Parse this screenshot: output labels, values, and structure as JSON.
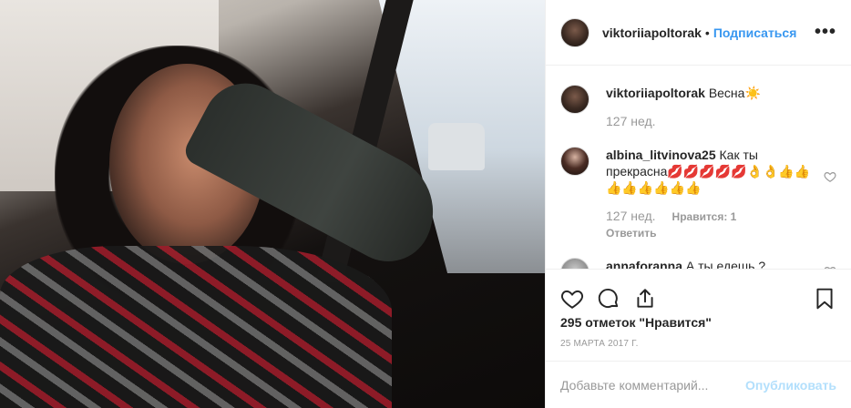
{
  "post": {
    "author": "viktoriiapoltorak",
    "separator": "•",
    "follow_label": "Подписаться",
    "more_label": "•••"
  },
  "comments": [
    {
      "user": "viktoriiapoltorak",
      "text": "Весна☀️",
      "time": "127 нед.",
      "likes": "",
      "reply": ""
    },
    {
      "user": "albina_litvinova25",
      "text": "Как ты прекрасна💋💋💋💋💋👌👌👍👍👍👍👍👍👍👍",
      "time": "127 нед.",
      "likes": "Нравится: 1",
      "reply": "Ответить"
    },
    {
      "user": "annaforanna",
      "text": "А ты едешь ?",
      "time": "",
      "likes": "",
      "reply": ""
    }
  ],
  "actions": {
    "like": "heart-icon",
    "comment": "comment-icon",
    "share": "share-icon",
    "save": "bookmark-icon"
  },
  "likes_count": "295 отметок \"Нравится\"",
  "date": "25 марта 2017 г.",
  "add_comment": {
    "placeholder": "Добавьте комментарий...",
    "publish_label": "Опубликовать"
  },
  "colors": {
    "accent": "#3897f0",
    "publish_disabled": "#b2dffc",
    "muted": "#999999",
    "text": "#262626"
  }
}
